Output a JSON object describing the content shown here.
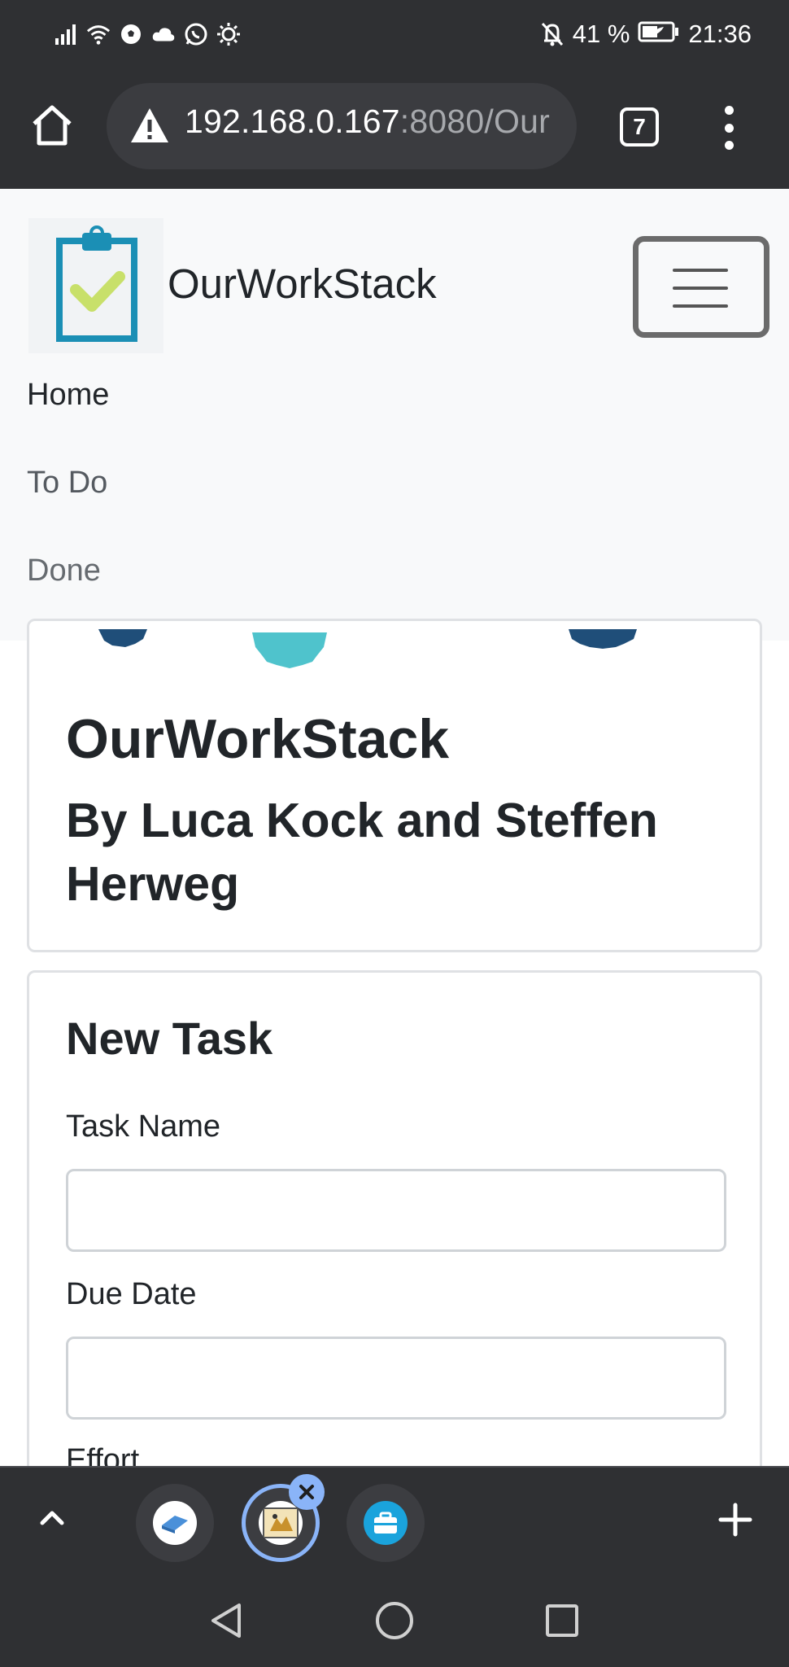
{
  "status_bar": {
    "battery_percent": "41 %",
    "time": "21:36",
    "icons": [
      "signal-icon",
      "wifi-icon",
      "soccer-icon",
      "cloud-icon",
      "whatsapp-icon",
      "brightness-icon",
      "mute-icon",
      "battery-icon"
    ]
  },
  "browser": {
    "url_host": "192.168.0.167",
    "url_rest": ":8080/Our",
    "tab_count": "7",
    "security_icon": "warning-icon"
  },
  "navbar": {
    "brand": "OurWorkStack",
    "links": [
      "Home",
      "To Do",
      "Done"
    ]
  },
  "hero": {
    "title": "OurWorkStack",
    "subtitle": "By Luca Kock and Steffen Herweg"
  },
  "form": {
    "title": "New Task",
    "task_name_label": "Task Name",
    "task_name_value": "",
    "due_date_label": "Due Date",
    "due_date_value": "",
    "effort_label": "Effort"
  },
  "colors": {
    "chrome_bg": "#2f3033",
    "navbar_bg": "#f8f9fa",
    "accent_blue": "#8ab4f8",
    "logo_teal": "#1b8fb5",
    "logo_check": "#c8e06a",
    "gear_navy": "#1f4e79",
    "gear_teal": "#4fc3cc"
  }
}
